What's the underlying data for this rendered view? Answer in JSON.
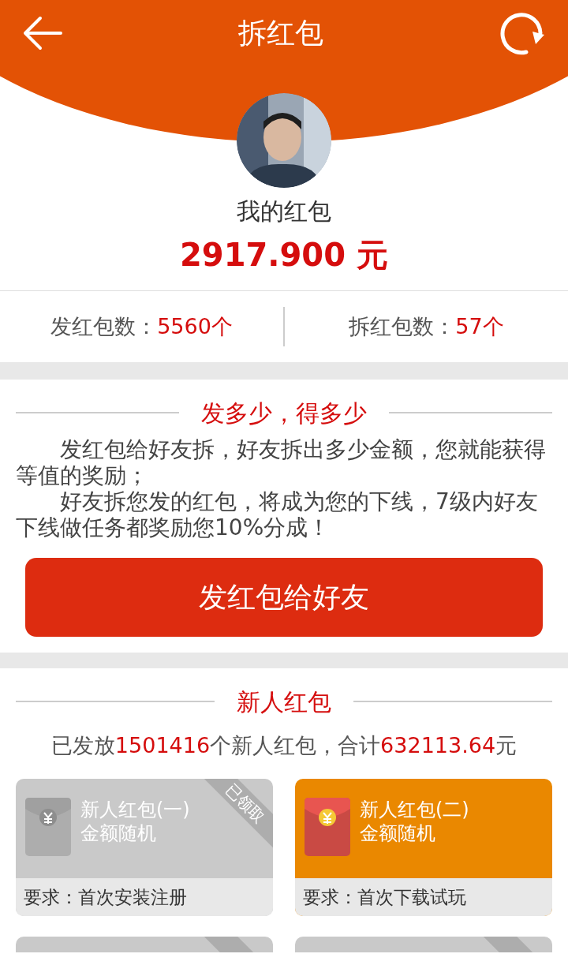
{
  "header": {
    "title": "拆红包"
  },
  "profile": {
    "label": "我的红包",
    "amount": "2917.900 元"
  },
  "stats": [
    {
      "label": "发红包数：",
      "value": "5560个"
    },
    {
      "label": "拆红包数：",
      "value": "57个"
    }
  ],
  "promo": {
    "title": "发多少，得多少",
    "paragraphs": [
      "发红包给好友拆，好友拆出多少金额，您就能获得等值的奖励；",
      "好友拆您发的红包，将成为您的下线，7级内好友下线做任务都奖励您10%分成！"
    ],
    "button": "发红包给好友"
  },
  "newcomer": {
    "title": "新人红包",
    "summary": [
      {
        "text": "已发放",
        "highlight": false
      },
      {
        "text": "1501416",
        "highlight": true
      },
      {
        "text": "个新人红包，合计",
        "highlight": false
      },
      {
        "text": "632113.64",
        "highlight": true
      },
      {
        "text": "元",
        "highlight": false
      }
    ],
    "cards": [
      {
        "title": "新人红包(一)",
        "subtitle": "金额随机",
        "requirement": "要求：首次安装注册",
        "claimed": true,
        "ribbon": "已领取"
      },
      {
        "title": "新人红包(二)",
        "subtitle": "金额随机",
        "requirement": "要求：首次下载试玩",
        "claimed": false
      }
    ],
    "cut_cards": [
      {
        "claimed": true
      },
      {
        "claimed": true
      }
    ]
  }
}
